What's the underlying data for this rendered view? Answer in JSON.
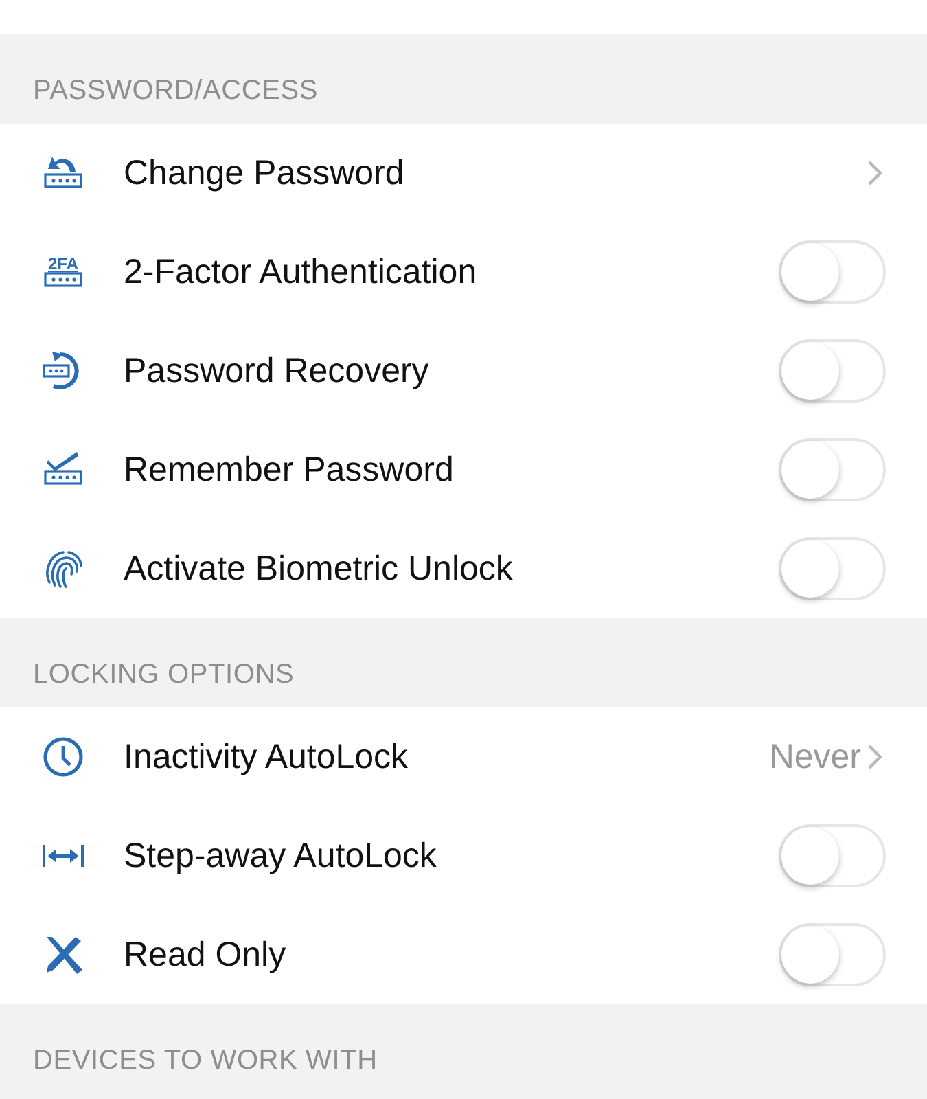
{
  "sections": [
    {
      "header": "PASSWORD/ACCESS",
      "rows": [
        {
          "kind": "link",
          "label": "Change Password"
        },
        {
          "kind": "toggle",
          "icon_text": "2FA",
          "label": "2-Factor Authentication",
          "on": false
        },
        {
          "kind": "toggle",
          "label": "Password Recovery",
          "on": false
        },
        {
          "kind": "toggle",
          "label": "Remember Password",
          "on": false
        },
        {
          "kind": "toggle",
          "label": "Activate Biometric Unlock",
          "on": false
        }
      ]
    },
    {
      "header": "LOCKING OPTIONS",
      "rows": [
        {
          "kind": "link",
          "label": "Inactivity AutoLock",
          "value": "Never"
        },
        {
          "kind": "toggle",
          "label": "Step-away AutoLock",
          "on": false
        },
        {
          "kind": "toggle",
          "label": "Read Only",
          "on": false
        }
      ]
    },
    {
      "header": "DEVICES TO WORK WITH"
    }
  ]
}
